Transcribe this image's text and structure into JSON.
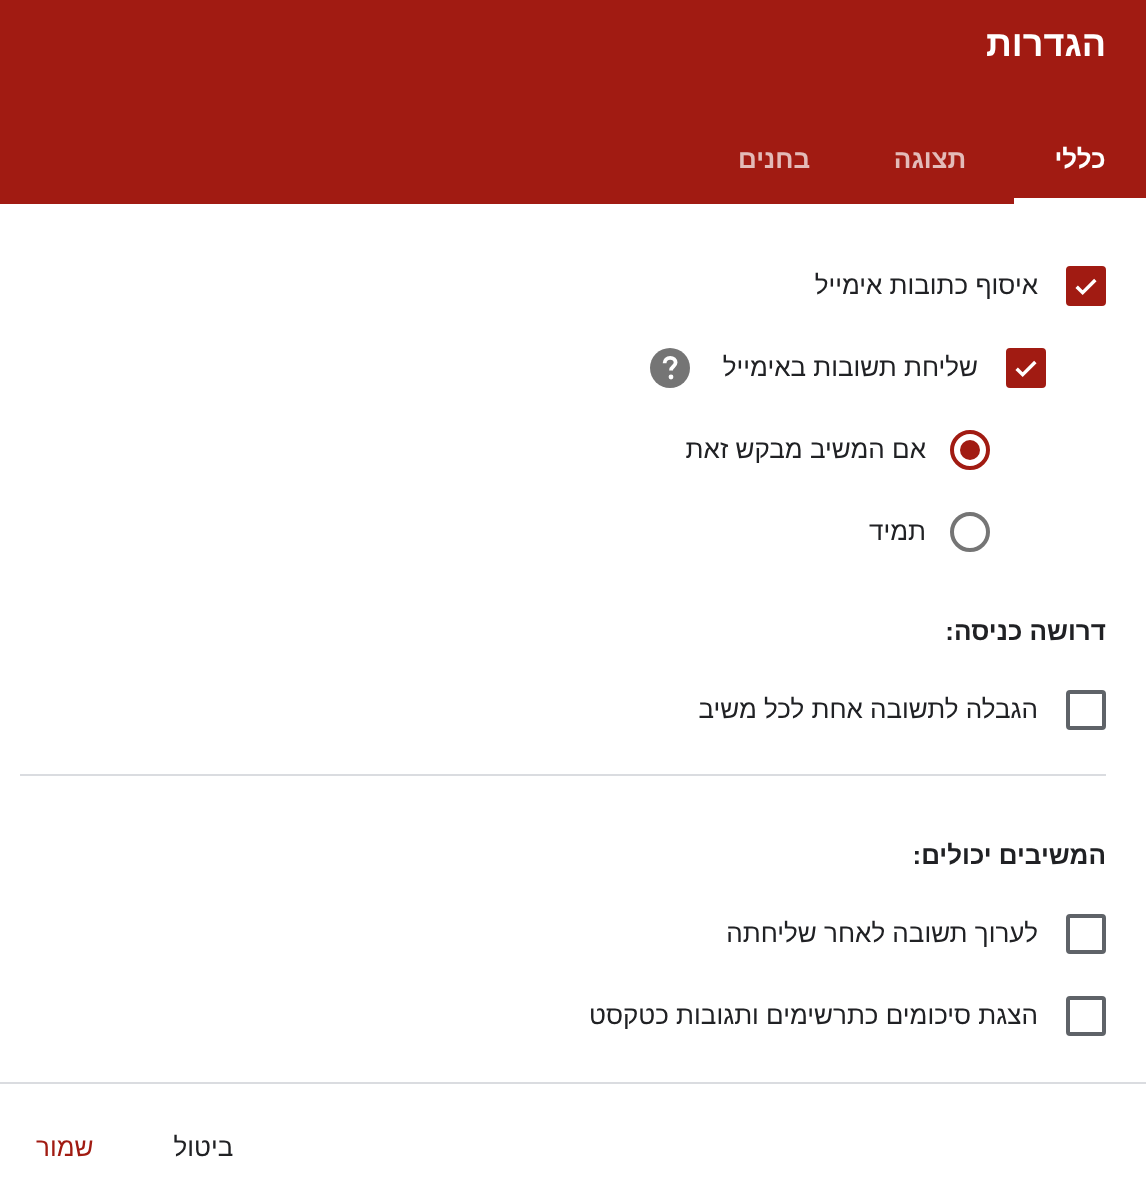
{
  "title": "הגדרות",
  "tabs": [
    {
      "label": "כללי",
      "selected": true
    },
    {
      "label": "תצוגה",
      "selected": false
    },
    {
      "label": "בחנים",
      "selected": false
    }
  ],
  "rows": [
    {
      "kind": "checkbox",
      "label": "איסוף כתובות אימייל",
      "checked": true,
      "children": [
        {
          "kind": "checkbox",
          "label": "שליחת תשובות באימייל",
          "checked": true,
          "help": true,
          "children": [
            {
              "kind": "radio",
              "label": "אם המשיב מבקש זאת",
              "selected": true
            },
            {
              "kind": "radio",
              "label": "תמיד",
              "selected": false
            }
          ]
        }
      ]
    },
    {
      "kind": "heading",
      "label": "דרושה כניסה:"
    },
    {
      "kind": "checkbox",
      "label": "הגבלה לתשובה אחת לכל משיב",
      "checked": false
    },
    {
      "kind": "divider"
    },
    {
      "kind": "heading",
      "label": "המשיבים יכולים:"
    },
    {
      "kind": "checkbox",
      "label": "לערוך תשובה לאחר שליחתה",
      "checked": false
    },
    {
      "kind": "checkbox",
      "label": "הצגת סיכומים כתרשימים ותגובות כטקסט",
      "checked": false
    }
  ],
  "buttons": [
    {
      "label": "ביטול",
      "kind": "secondary"
    },
    {
      "label": "שמור",
      "kind": "primary"
    }
  ]
}
